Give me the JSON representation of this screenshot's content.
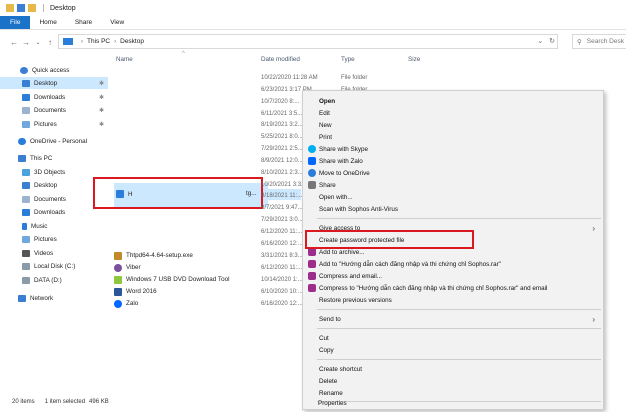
{
  "window": {
    "title": "Desktop"
  },
  "ribbon": {
    "tabs": [
      "File",
      "Home",
      "Share",
      "View"
    ]
  },
  "address": {
    "crumbs": [
      "This PC",
      "Desktop"
    ],
    "search_placeholder": "Search Desk"
  },
  "sidebar": {
    "quick_access": "Quick access",
    "items": [
      "Desktop",
      "Downloads",
      "Documents",
      "Pictures",
      "OneDrive - Personal",
      "This PC",
      "3D Objects",
      "Desktop",
      "Documents",
      "Downloads",
      "Music",
      "Pictures",
      "Videos",
      "Local Disk (C:)",
      "DATA (D:)",
      "Network"
    ]
  },
  "columns": {
    "name": "Name",
    "date": "Date modified",
    "type": "Type",
    "size": "Size"
  },
  "dates": [
    "10/22/2020 11:28 AM",
    "6/23/2021 3:17 PM",
    "10/7/2020 8:...",
    "6/11/2021 3:5...",
    "8/19/2021 3:2...",
    "5/25/2021 8:0...",
    "7/29/2021 2:5...",
    "8/9/2021 12:0...",
    "8/10/2021 2:3...",
    "10/20/2021 3:3...",
    "8/18/2021 11:...",
    "8/7/2021 9:47...",
    "7/29/2021 3:0...",
    "6/12/2020 11:...",
    "6/16/2020 12:...",
    "3/31/2021 8:3...",
    "6/12/2020 11:...",
    "10/14/2020 1:...",
    "6/10/2020 10:...",
    "6/16/2020 12:..."
  ],
  "types": [
    "File folder",
    "File folder"
  ],
  "selected_file": {
    "name_start": "H",
    "name_end": "tg..."
  },
  "files": [
    "Thtpd64-4.64-setup.exe",
    "Viber",
    "Windows 7 USB DVD Download Tool",
    "Word 2016",
    "Zalo"
  ],
  "status": {
    "count": "20 items",
    "selection": "1 item selected",
    "size": "496 KB"
  },
  "menu": {
    "open": "Open",
    "edit": "Edit",
    "new": "New",
    "print": "Print",
    "share_skype": "Share with Skype",
    "share_zalo": "Share with Zalo",
    "move_onedrive": "Move to OneDrive",
    "share": "Share",
    "open_with": "Open with...",
    "scan": "Scan with Sophos Anti-Virus",
    "give_access": "Give access to",
    "create_password": "Create password protected file",
    "add_archive": "Add to archive...",
    "add_rar": "Add to \"Hướng dẫn cách đăng nhập và thi chứng chỉ Sophos.rar\"",
    "compress_email": "Compress and email...",
    "compress_rar_email": "Compress to \"Hướng dẫn cách đăng nhập và thi chứng chỉ Sophos.rar\" and email",
    "restore": "Restore previous versions",
    "send_to": "Send to",
    "cut": "Cut",
    "copy": "Copy",
    "create_shortcut": "Create shortcut",
    "delete": "Delete",
    "rename": "Rename",
    "properties": "Properties"
  },
  "colors": {
    "accent": "#1a73c9",
    "selection": "#cce8ff",
    "highlight_box": "#d9181f",
    "folder": "#e8b84a"
  }
}
